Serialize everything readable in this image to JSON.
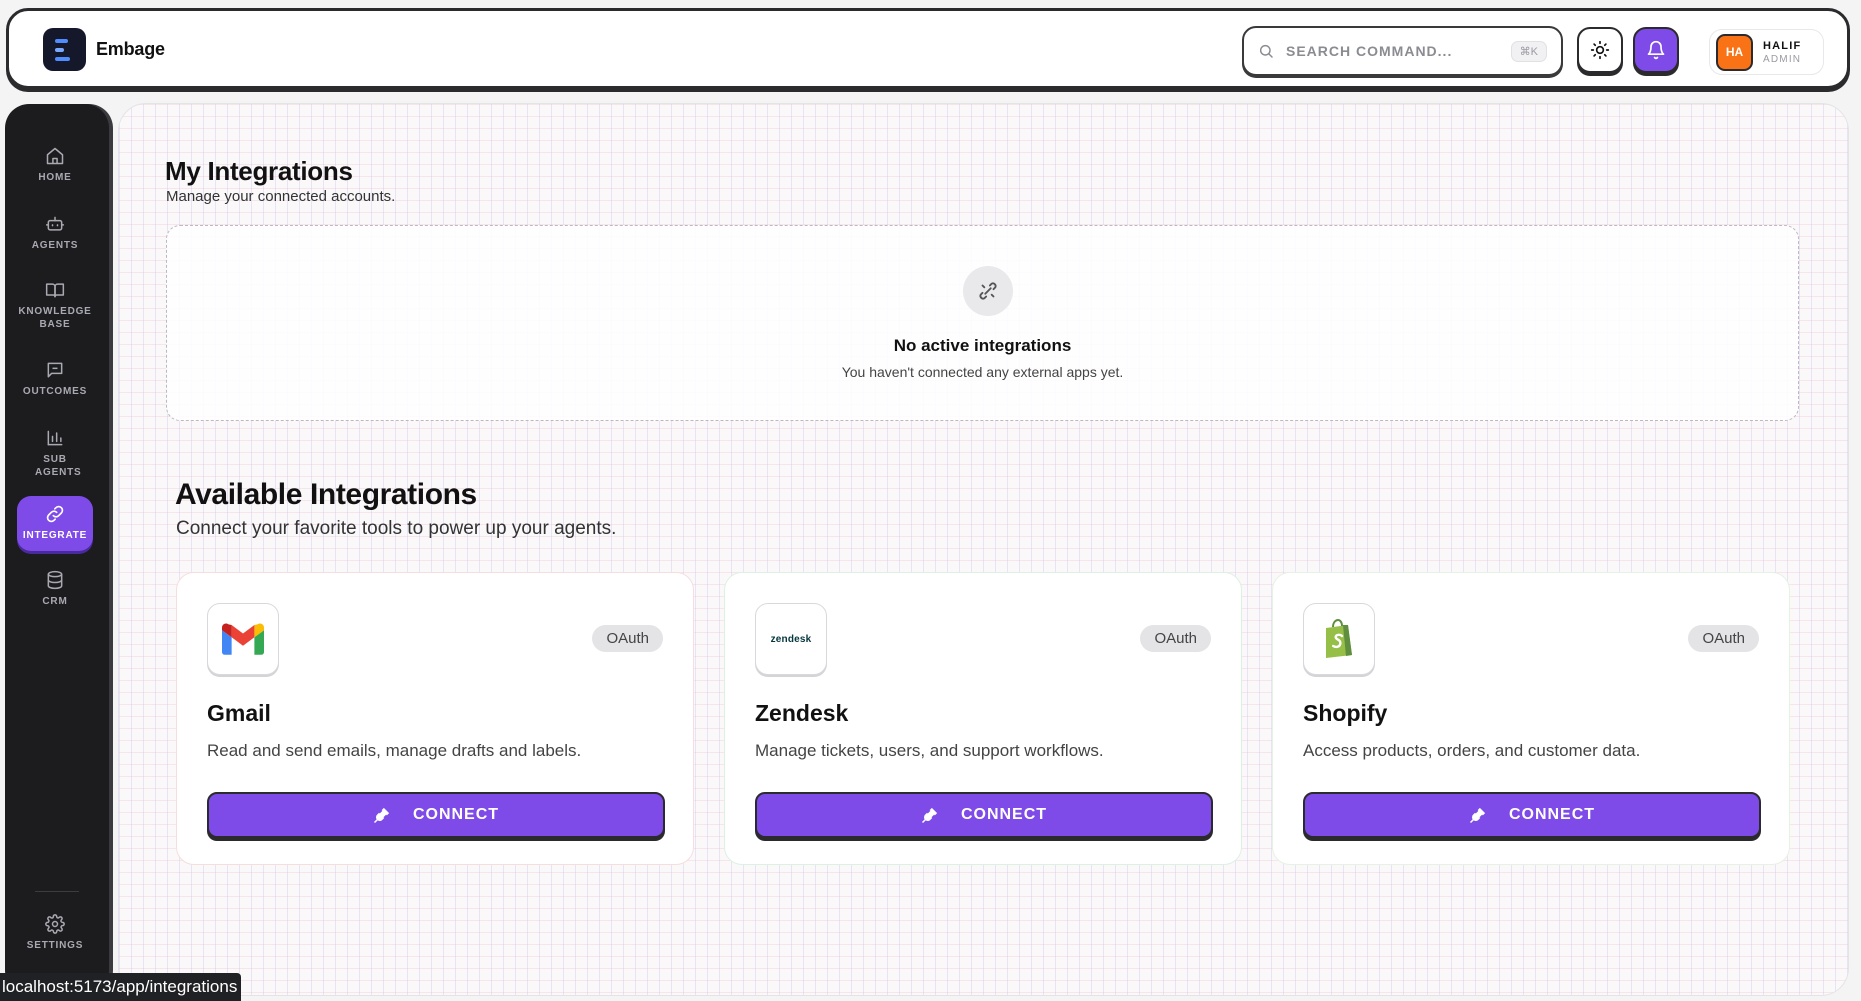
{
  "app": {
    "name": "Embage"
  },
  "header": {
    "search_placeholder": "SEARCH COMMAND...",
    "search_shortcut": "⌘K",
    "user": {
      "initials": "HA",
      "name": "HALIF",
      "role": "ADMIN"
    }
  },
  "sidebar": {
    "items": [
      {
        "label": "HOME",
        "icon": "home-icon"
      },
      {
        "label": "AGENTS",
        "icon": "robot-icon"
      },
      {
        "label": "KNOWLEDGE BASE",
        "icon": "book-icon"
      },
      {
        "label": "OUTCOMES",
        "icon": "message-icon"
      },
      {
        "label": "SUB AGENTS",
        "icon": "bar-chart-icon"
      },
      {
        "label": "INTEGRATE",
        "icon": "link-icon",
        "active": true
      },
      {
        "label": "CRM",
        "icon": "database-icon"
      }
    ],
    "footer": {
      "label": "SETTINGS",
      "icon": "gear-icon"
    }
  },
  "my_integrations": {
    "title": "My Integrations",
    "subtitle": "Manage your connected accounts.",
    "empty_title": "No active integrations",
    "empty_subtitle": "You haven't connected any external apps yet."
  },
  "available": {
    "title": "Available Integrations",
    "subtitle": "Connect your favorite tools to power up your agents.",
    "cards": [
      {
        "name": "Gmail",
        "badge": "OAuth",
        "description": "Read and send emails, manage drafts and labels.",
        "button": "CONNECT",
        "logo": "gmail-logo"
      },
      {
        "name": "Zendesk",
        "badge": "OAuth",
        "description": "Manage tickets, users, and support workflows.",
        "button": "CONNECT",
        "logo": "zendesk-logo",
        "logo_text": "zendesk"
      },
      {
        "name": "Shopify",
        "badge": "OAuth",
        "description": "Access products, orders, and customer data.",
        "button": "CONNECT",
        "logo": "shopify-logo"
      }
    ]
  },
  "status_bar": {
    "url": "localhost:5173/app/integrations"
  },
  "colors": {
    "accent": "#7e4be8",
    "sidebar": "#1c1c1f",
    "avatar": "#f97316"
  }
}
